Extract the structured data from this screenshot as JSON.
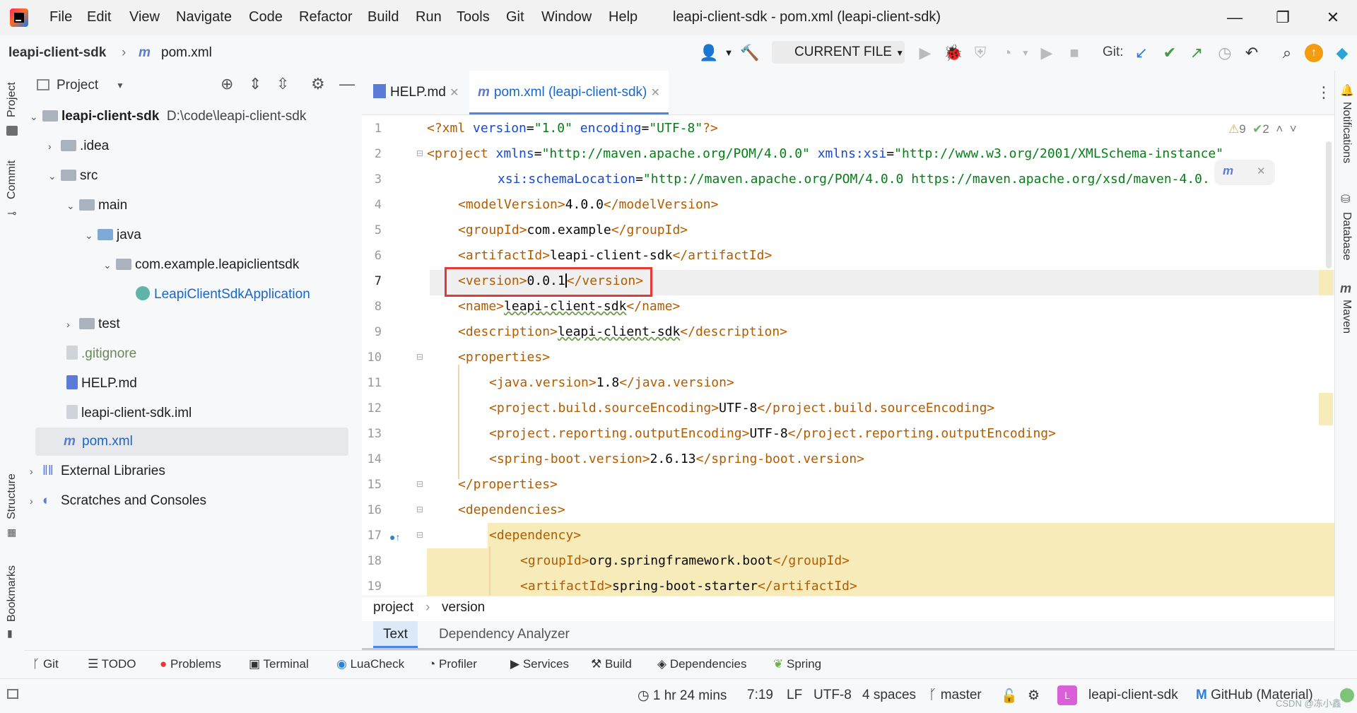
{
  "window": {
    "title": "leapi-client-sdk - pom.xml (leapi-client-sdk)",
    "menu": [
      "File",
      "Edit",
      "View",
      "Navigate",
      "Code",
      "Refactor",
      "Build",
      "Run",
      "Tools",
      "Git",
      "Window",
      "Help"
    ],
    "minimize": "—",
    "restore": "❐",
    "close": "✕"
  },
  "navbar": {
    "project": "leapi-client-sdk",
    "file": "pom.xml",
    "run_config": "CURRENT FILE",
    "git_label": "Git:"
  },
  "left_stripe": {
    "project": "Project",
    "commit": "Commit",
    "structure": "Structure",
    "bookmarks": "Bookmarks"
  },
  "project_panel": {
    "title": "Project",
    "tree": [
      {
        "label": "leapi-client-sdk",
        "path": "D:\\code\\leapi-client-sdk"
      },
      {
        "label": ".idea"
      },
      {
        "label": "src"
      },
      {
        "label": "main"
      },
      {
        "label": "java"
      },
      {
        "label": "com.example.leapiclientsdk"
      },
      {
        "label": "LeapiClientSdkApplication"
      },
      {
        "label": "test"
      },
      {
        "label": ".gitignore"
      },
      {
        "label": "HELP.md"
      },
      {
        "label": "leapi-client-sdk.iml"
      },
      {
        "label": "pom.xml"
      },
      {
        "label": "External Libraries"
      },
      {
        "label": "Scratches and Consoles"
      }
    ]
  },
  "editor_tabs": [
    {
      "label": "HELP.md"
    },
    {
      "label": "pom.xml (leapi-client-sdk)"
    }
  ],
  "inspections": {
    "warnings": "9",
    "ok": "2"
  },
  "line_numbers": [
    "1",
    "2",
    "3",
    "4",
    "5",
    "6",
    "7",
    "8",
    "9",
    "10",
    "11",
    "12",
    "13",
    "14",
    "15",
    "16",
    "17",
    "18",
    "19"
  ],
  "code": {
    "l1": {
      "a": "<?xml ",
      "b": "version",
      "c": "=",
      "d": "\"1.0\"",
      "e": " ",
      "f": "encoding",
      "g": "=",
      "h": "\"UTF-8\"",
      "i": "?>"
    },
    "l2": {
      "a": "<project ",
      "b": "xmlns",
      "c": "=",
      "d": "\"http://maven.apache.org/POM/4.0.0\"",
      "e": " ",
      "f": "xmlns:xsi",
      "g": "=",
      "h": "\"http://www.w3.org/2001/XMLSchema-instance\""
    },
    "l3": {
      "a": "xsi:schemaLocation",
      "b": "=",
      "c": "\"http://maven.apache.org/POM/4.0.0 https://maven.apache.org/xsd/maven-4.0."
    },
    "l4": {
      "open": "<modelVersion>",
      "text": "4.0.0",
      "close": "</modelVersion>"
    },
    "l5": {
      "open": "<groupId>",
      "text": "com.example",
      "close": "</groupId>"
    },
    "l6": {
      "open": "<artifactId>",
      "text": "leapi-client-sdk",
      "close": "</artifactId>"
    },
    "l7": {
      "open": "<version>",
      "text": "0.0.1",
      "close": "</version>"
    },
    "l8": {
      "open": "<name>",
      "text": "leapi-client-sdk",
      "close": "</name>"
    },
    "l9": {
      "open": "<description>",
      "text": "leapi-client-sdk",
      "close": "</description>"
    },
    "l10": {
      "open": "<properties>"
    },
    "l11": {
      "open": "<java.version>",
      "text": "1.8",
      "close": "</java.version>"
    },
    "l12": {
      "open": "<project.build.sourceEncoding>",
      "text": "UTF-8",
      "close": "</project.build.sourceEncoding>"
    },
    "l13": {
      "open": "<project.reporting.outputEncoding>",
      "text": "UTF-8",
      "close": "</project.reporting.outputEncoding>"
    },
    "l14": {
      "open": "<spring-boot.version>",
      "text": "2.6.13",
      "close": "</spring-boot.version>"
    },
    "l15": {
      "close": "</properties>"
    },
    "l16": {
      "open": "<dependencies>"
    },
    "l17": {
      "open": "<dependency>"
    },
    "l18": {
      "open": "<groupId>",
      "text": "org.springframework.boot",
      "close": "</groupId>"
    },
    "l19": {
      "open": "<artifactId>",
      "text": "spring-boot-starter",
      "close": "</artifactId>"
    }
  },
  "editor_breadcrumb": {
    "a": "project",
    "b": "version"
  },
  "editor_bottom_tabs": {
    "text": "Text",
    "analyzer": "Dependency Analyzer"
  },
  "right_stripe": {
    "notifications": "Notifications",
    "database": "Database",
    "maven": "Maven"
  },
  "tool_windows": [
    "Git",
    "TODO",
    "Problems",
    "Terminal",
    "LuaCheck",
    "Profiler",
    "Services",
    "Build",
    "Dependencies",
    "Spring"
  ],
  "status": {
    "time": "1 hr 24 mins",
    "position": "7:19",
    "line_sep": "LF",
    "encoding": "UTF-8",
    "indent": "4 spaces",
    "branch": "master",
    "project": "leapi-client-sdk",
    "theme": "GitHub (Material)",
    "watermark": "CSDN @冻小鑫"
  },
  "colors": {
    "accent": "#4a86e8",
    "highlight_box": "#e53935",
    "tag": "#b15c00",
    "attr": "#174ad4",
    "string": "#067d17"
  }
}
